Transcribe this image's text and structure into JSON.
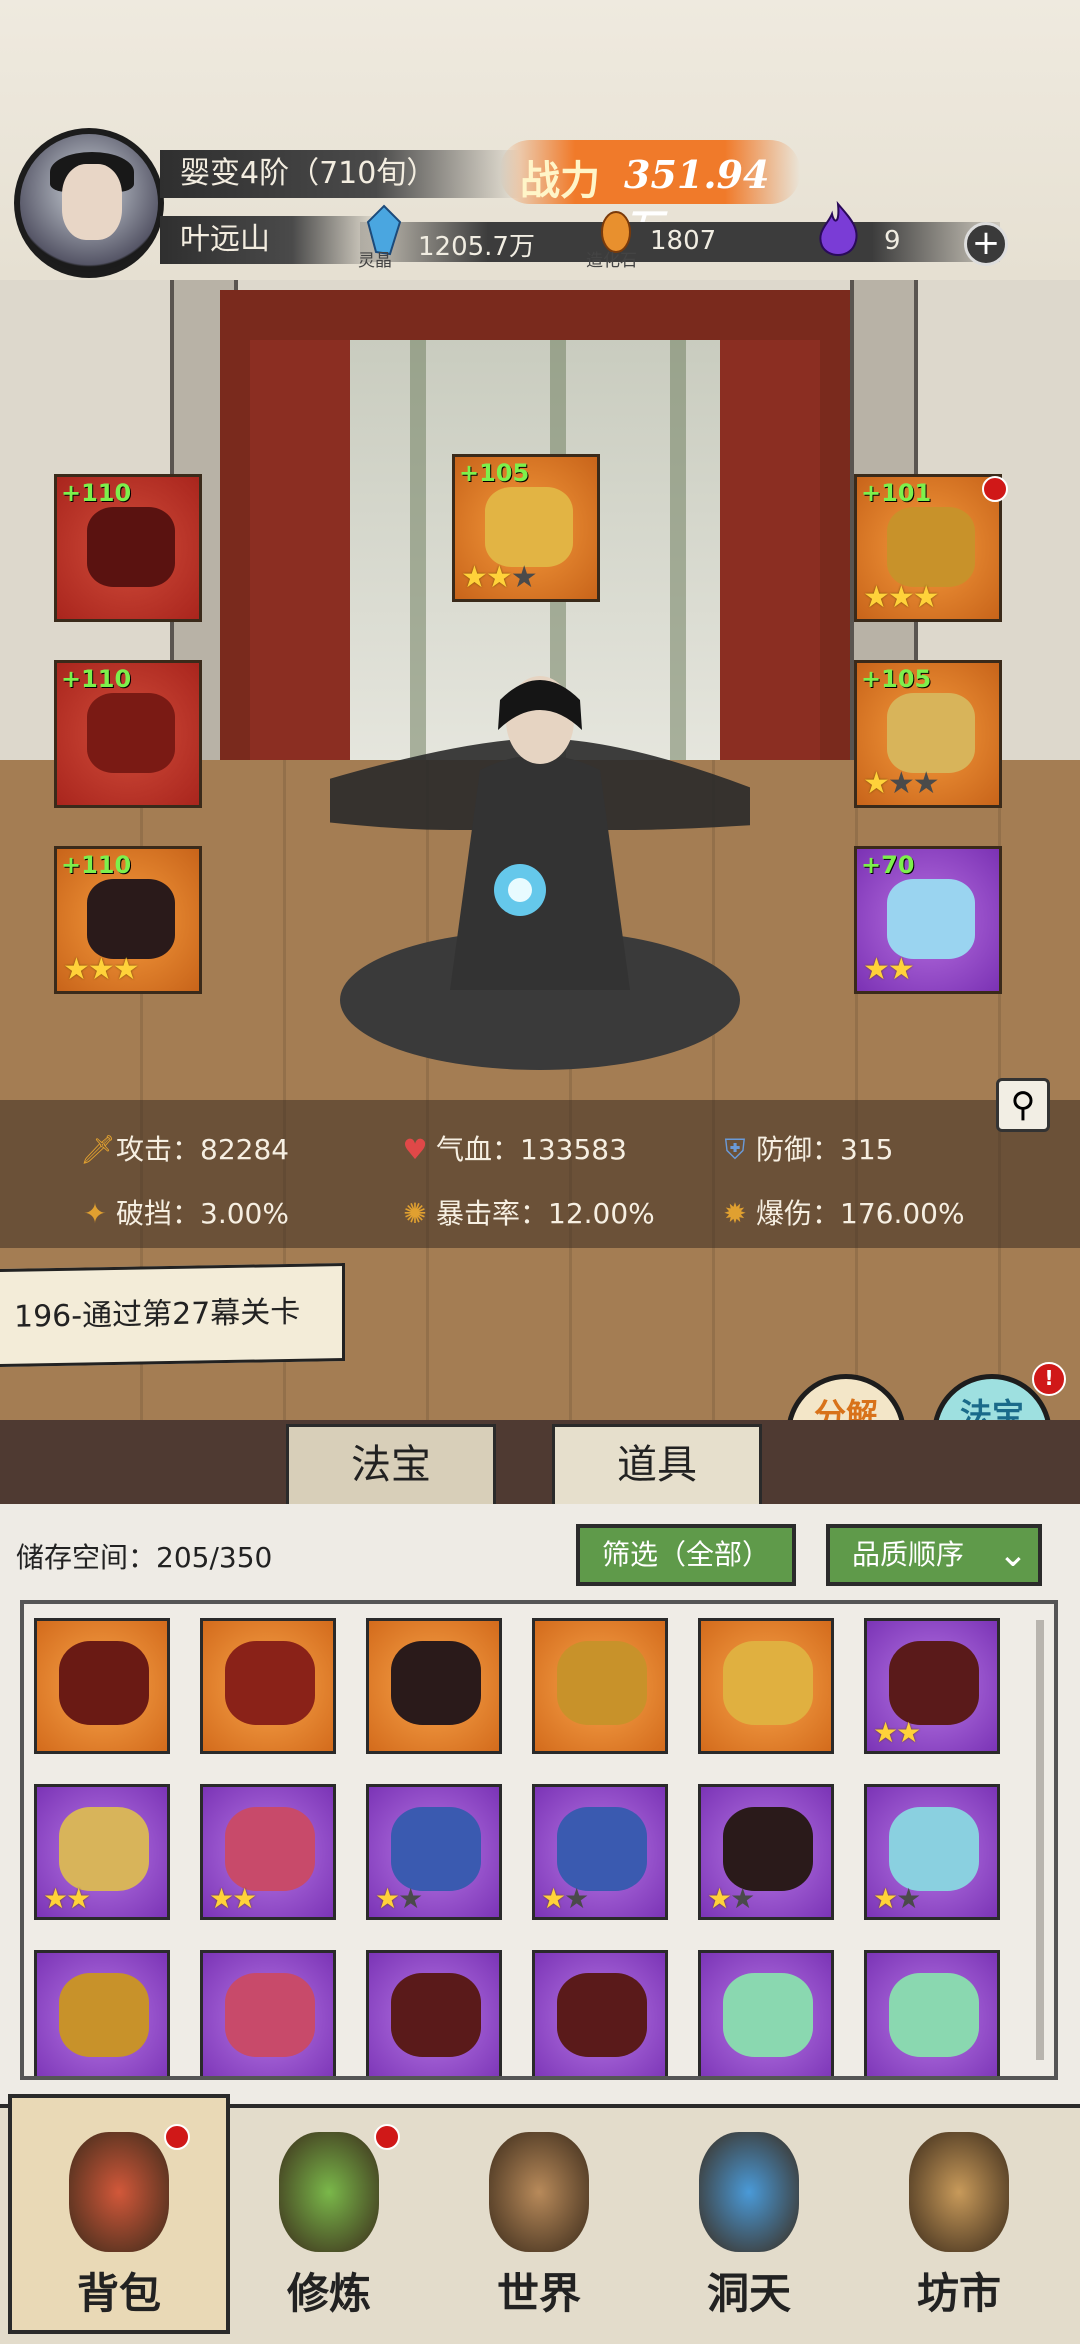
{
  "player": {
    "name": "叶远山",
    "realm": "婴变4阶（710旬）",
    "power_label": "战力",
    "power_value": "351.94万"
  },
  "currencies": [
    {
      "name": "灵晶",
      "value": "1205.7万",
      "icon": "blue-crystal-icon",
      "color": "#4aa6e0"
    },
    {
      "name": "造化石",
      "value": "1807",
      "icon": "orange-stone-icon",
      "color": "#e8902e"
    },
    {
      "name": "",
      "value": "9",
      "icon": "purple-flame-icon",
      "color": "#7a3cd6"
    }
  ],
  "equipped": {
    "weapon": {
      "level": "+110",
      "stars": 0,
      "max": 0,
      "quality": "red"
    },
    "helmet": {
      "level": "+110",
      "stars": 0,
      "max": 0,
      "quality": "red"
    },
    "boots": {
      "level": "+110",
      "stars": 3,
      "max": 3,
      "quality": "orange"
    },
    "treasure": {
      "level": "+105",
      "stars": 2,
      "max": 3,
      "quality": "orange"
    },
    "ring": {
      "level": "+101",
      "stars": 3,
      "max": 3,
      "quality": "orange",
      "badge": true
    },
    "amulet": {
      "level": "+105",
      "stars": 1,
      "max": 3,
      "quality": "orange"
    },
    "bracelet": {
      "level": "+70",
      "stars": 2,
      "max": 2,
      "quality": "purple"
    }
  },
  "stats": {
    "attack": "攻击：82284",
    "hp": "气血：133583",
    "defense": "防御：315",
    "break": "破挡：3.00%",
    "crit_rate": "暴击率：12.00%",
    "crit_dmg": "爆伤：176.00%"
  },
  "quest": "196-通过第27幕关卡",
  "side_buttons": {
    "decompose": "分解再造",
    "synthesize": "法宝合成"
  },
  "tabs": {
    "treasure": "法宝",
    "items": "道具"
  },
  "inventory": {
    "storage": "储存空间：205/350",
    "filter": "筛选（全部）",
    "sort": "品质顺序",
    "items": [
      {
        "quality": "orange",
        "stars": 0,
        "max": 0,
        "art": "#6a1a14"
      },
      {
        "quality": "orange",
        "stars": 0,
        "max": 0,
        "art": "#8a2218"
      },
      {
        "quality": "orange",
        "stars": 0,
        "max": 0,
        "art": "#2a1a1a"
      },
      {
        "quality": "orange",
        "stars": 0,
        "max": 0,
        "art": "#c8922a"
      },
      {
        "quality": "orange",
        "stars": 0,
        "max": 0,
        "art": "#e0b040"
      },
      {
        "quality": "purple",
        "stars": 2,
        "max": 2,
        "art": "#5a1a1a"
      },
      {
        "quality": "purple",
        "stars": 2,
        "max": 2,
        "art": "#d8b45a"
      },
      {
        "quality": "purple",
        "stars": 2,
        "max": 2,
        "art": "#c84a6a"
      },
      {
        "quality": "purple",
        "stars": 1,
        "max": 2,
        "art": "#3a5ab0"
      },
      {
        "quality": "purple",
        "stars": 1,
        "max": 2,
        "art": "#3a5ab0"
      },
      {
        "quality": "purple",
        "stars": 1,
        "max": 2,
        "art": "#2a1a1a"
      },
      {
        "quality": "purple",
        "stars": 1,
        "max": 2,
        "art": "#8ad0e0"
      },
      {
        "quality": "purple",
        "stars": 0,
        "max": 0,
        "art": "#c8922a"
      },
      {
        "quality": "purple",
        "stars": 0,
        "max": 0,
        "art": "#c84a6a"
      },
      {
        "quality": "purple",
        "stars": 0,
        "max": 0,
        "art": "#5a1a1a"
      },
      {
        "quality": "purple",
        "stars": 0,
        "max": 0,
        "art": "#5a1a1a"
      },
      {
        "quality": "purple",
        "stars": 0,
        "max": 0,
        "art": "#8ad8b0"
      },
      {
        "quality": "purple",
        "stars": 0,
        "max": 0,
        "art": "#8ad8b0"
      }
    ]
  },
  "nav": [
    {
      "label": "背包",
      "icon": "bag-icon",
      "color": "#d2583a",
      "badge": true
    },
    {
      "label": "修炼",
      "icon": "lotus-icon",
      "color": "#7ab84a",
      "badge": true
    },
    {
      "label": "世界",
      "icon": "scroll-map-icon",
      "color": "#b88a5a",
      "badge": false
    },
    {
      "label": "洞天",
      "icon": "portal-icon",
      "color": "#4a9ad8",
      "badge": false
    },
    {
      "label": "坊市",
      "icon": "market-icon",
      "color": "#c89a5a",
      "badge": false
    }
  ]
}
